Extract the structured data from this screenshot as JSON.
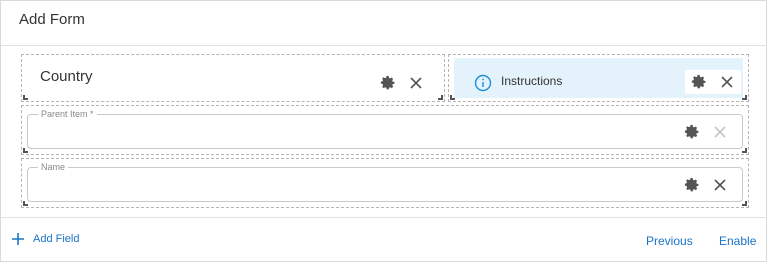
{
  "dialog": {
    "title": "Add Form"
  },
  "items": {
    "country": {
      "title": "Country"
    },
    "instructions": {
      "label": "Instructions",
      "bg_color": "#e4f3fb"
    },
    "parent_item": {
      "label": "Parent Item *"
    },
    "name": {
      "label": "Name"
    }
  },
  "footer": {
    "add_field_label": "Add Field",
    "previous_label": "Previous",
    "enable_label": "Enable",
    "link_color": "#1a73c8"
  },
  "icons": [
    "gear-icon",
    "close-icon",
    "info-icon",
    "plus-icon"
  ]
}
